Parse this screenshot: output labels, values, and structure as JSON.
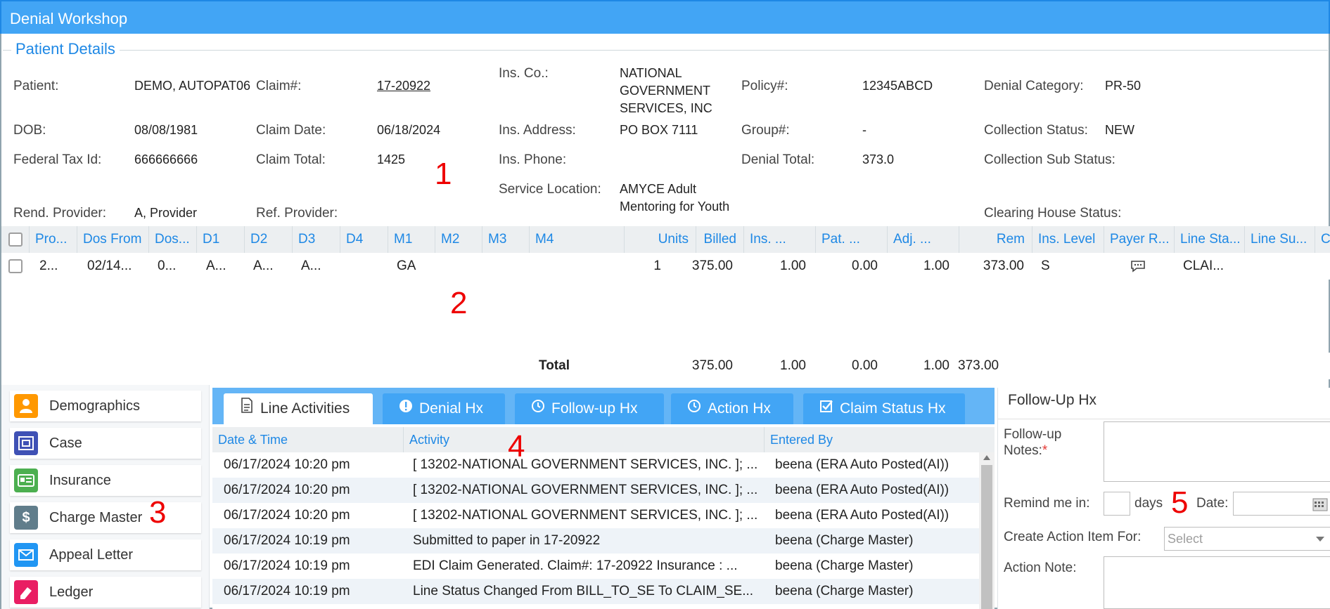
{
  "window": {
    "title": "Denial Workshop"
  },
  "patient_details": {
    "legend": "Patient Details",
    "fields": {
      "patient": {
        "label": "Patient:",
        "value": "DEMO, AUTOPAT06"
      },
      "claim_no": {
        "label": "Claim#:",
        "value": "17-20922"
      },
      "ins_co": {
        "label": "Ins. Co.:",
        "value_lines": [
          "NATIONAL",
          "GOVERNMENT",
          "SERVICES, INC"
        ]
      },
      "policy_no": {
        "label": "Policy#:",
        "value": "12345ABCD"
      },
      "denial_category": {
        "label": "Denial Category:",
        "value": "PR-50"
      },
      "dob": {
        "label": "DOB:",
        "value": "08/08/1981"
      },
      "claim_date": {
        "label": "Claim Date:",
        "value": "06/18/2024"
      },
      "ins_address": {
        "label": "Ins. Address:",
        "value": "PO BOX 7111"
      },
      "group_no": {
        "label": "Group#:",
        "value": "-"
      },
      "collection_status": {
        "label": "Collection Status:",
        "value": "NEW"
      },
      "federal_tax_id": {
        "label": "Federal Tax Id:",
        "value": "666666666"
      },
      "claim_total": {
        "label": "Claim Total:",
        "value": "1425"
      },
      "ins_phone": {
        "label": "Ins. Phone:",
        "value": ""
      },
      "denial_total": {
        "label": "Denial Total:",
        "value": "373.0"
      },
      "collection_sub_status": {
        "label": "Collection Sub Status:",
        "value": ""
      },
      "service_location": {
        "label": "Service Location:",
        "value_lines": [
          "AMYCE Adult",
          "Mentoring for Youth"
        ]
      },
      "rend_provider": {
        "label": "Rend. Provider:",
        "value": "A, Provider"
      },
      "ref_provider": {
        "label": "Ref. Provider:",
        "value": ""
      },
      "clearing_house_status": {
        "label": "Clearing House Status:",
        "value": ""
      }
    }
  },
  "markers": [
    "1",
    "2",
    "3",
    "4",
    "5"
  ],
  "line_grid": {
    "columns": [
      "Pro...",
      "Dos From",
      "Dos...",
      "D1",
      "D2",
      "D3",
      "D4",
      "M1",
      "M2",
      "M3",
      "M4",
      "Units",
      "Billed",
      "Ins. ...",
      "Pat. ...",
      "Adj. ...",
      "Rem",
      "Ins. Level",
      "Payer R...",
      "Line Sta...",
      "Line Su...",
      "C..."
    ],
    "rows": [
      {
        "pro": "2...",
        "dos_from": "02/14...",
        "dos_to": "0...",
        "d1": "A...",
        "d2": "A...",
        "d3": "A...",
        "d4": "",
        "m1": "GA",
        "m2": "",
        "m3": "",
        "m4": "",
        "units": "1",
        "billed": "375.00",
        "ins": "1.00",
        "pat": "0.00",
        "adj": "1.00",
        "rem": "373.00",
        "ins_level": "S",
        "payer_remark_icon": "speech-bubble-icon",
        "line_status": "CLAI...",
        "line_sub": ""
      }
    ],
    "totals": {
      "label": "Total",
      "billed": "375.00",
      "ins": "1.00",
      "pat": "0.00",
      "adj": "1.00",
      "rem": "373.00"
    }
  },
  "left_nav": {
    "items": [
      {
        "label": "Demographics",
        "icon": "person-icon",
        "color": "#ff9800"
      },
      {
        "label": "Case",
        "icon": "case-icon",
        "color": "#3f51b5"
      },
      {
        "label": "Insurance",
        "icon": "id-card-icon",
        "color": "#4caf50"
      },
      {
        "label": "Charge Master",
        "icon": "dollar-icon",
        "color": "#607d8b"
      },
      {
        "label": "Appeal Letter",
        "icon": "envelope-icon",
        "color": "#2196f3"
      },
      {
        "label": "Ledger",
        "icon": "eraser-icon",
        "color": "#e91e63"
      }
    ]
  },
  "tabs": [
    {
      "label": "Line Activities",
      "icon": "document-icon",
      "active": true
    },
    {
      "label": "Denial Hx",
      "icon": "exclamation-icon",
      "active": false
    },
    {
      "label": "Follow-up Hx",
      "icon": "clock-icon",
      "active": false
    },
    {
      "label": "Action Hx",
      "icon": "clock-icon",
      "active": false
    },
    {
      "label": "Claim Status Hx",
      "icon": "checkbox-icon",
      "active": false
    }
  ],
  "activities": {
    "columns": [
      "Date & Time",
      "Activity",
      "Entered By"
    ],
    "rows": [
      {
        "datetime": "06/17/2024 10:20 pm",
        "activity": "[ 13202-NATIONAL GOVERNMENT SERVICES, INC. ]; ...",
        "entered_by": "beena (ERA Auto Posted(AI))"
      },
      {
        "datetime": "06/17/2024 10:20 pm",
        "activity": "[ 13202-NATIONAL GOVERNMENT SERVICES, INC. ]; ...",
        "entered_by": "beena (ERA Auto Posted(AI))"
      },
      {
        "datetime": "06/17/2024 10:20 pm",
        "activity": "[ 13202-NATIONAL GOVERNMENT SERVICES, INC. ]; ...",
        "entered_by": "beena (ERA Auto Posted(AI))"
      },
      {
        "datetime": "06/17/2024 10:19 pm",
        "activity": "Submitted to paper in 17-20922",
        "entered_by": "beena (Charge Master)"
      },
      {
        "datetime": "06/17/2024 10:19 pm",
        "activity": "EDI Claim Generated. Claim#: 17-20922 Insurance : ...",
        "entered_by": "beena (Charge Master)"
      },
      {
        "datetime": "06/17/2024 10:19 pm",
        "activity": "Line Status Changed From BILL_TO_SE To CLAIM_SE...",
        "entered_by": "beena (Charge Master)"
      }
    ]
  },
  "followup": {
    "title": "Follow-Up Hx",
    "notes_label_1": "Follow-up",
    "notes_label_2": "Notes:",
    "required_mark": "*",
    "remind_label": "Remind me in:",
    "days_label": "days",
    "date_label": "Date:",
    "action_item_label": "Create Action Item For:",
    "action_item_value": "Select",
    "action_note_label": "Action Note:"
  }
}
